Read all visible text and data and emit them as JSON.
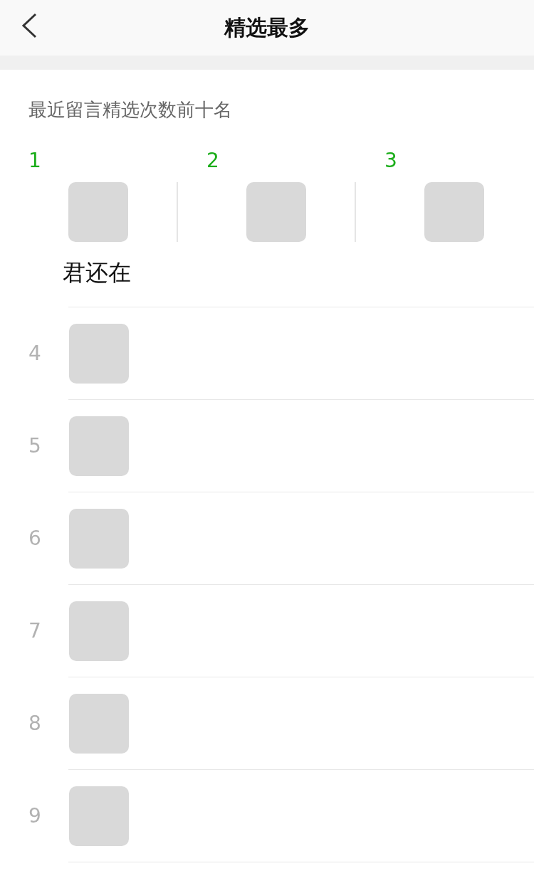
{
  "header": {
    "title": "精选最多"
  },
  "subtitle": "最近留言精选次数前十名",
  "top_three": [
    {
      "rank": "1",
      "name": "君还在"
    },
    {
      "rank": "2"
    },
    {
      "rank": "3"
    }
  ],
  "ranking": [
    {
      "rank": "4"
    },
    {
      "rank": "5"
    },
    {
      "rank": "6"
    },
    {
      "rank": "7"
    },
    {
      "rank": "8"
    },
    {
      "rank": "9"
    }
  ]
}
